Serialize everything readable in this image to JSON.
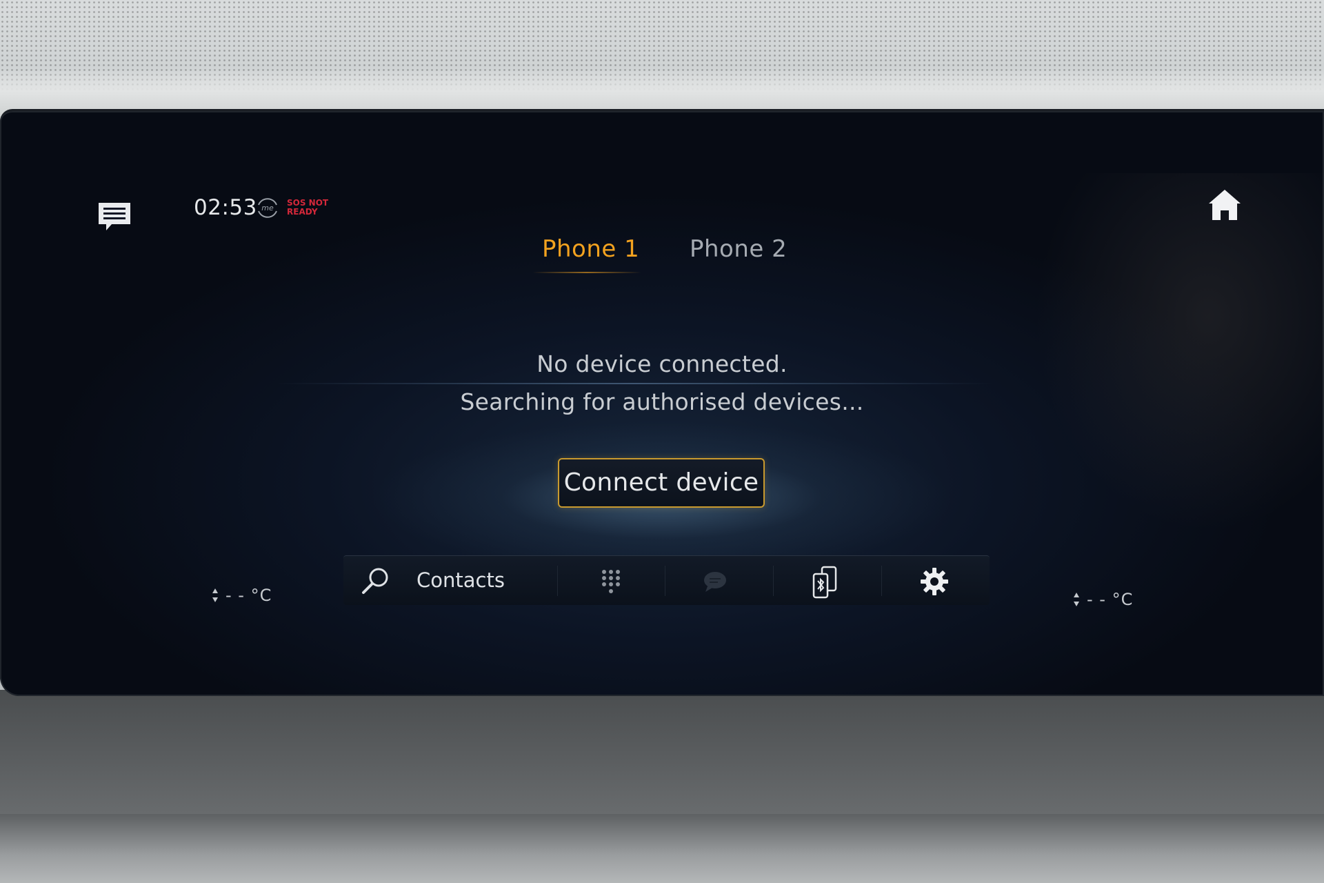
{
  "status_bar": {
    "time": "02:53",
    "me_label": "me",
    "sos_line1": "SOS NOT",
    "sos_line2": "READY"
  },
  "tabs": [
    {
      "label": "Phone 1",
      "active": true
    },
    {
      "label": "Phone 2",
      "active": false
    }
  ],
  "main": {
    "message_line1": "No device connected.",
    "message_line2": "Searching for authorised devices...",
    "connect_button": "Connect device"
  },
  "bottom_bar": {
    "contacts_label": "Contacts",
    "icons": [
      "search-icon",
      "keypad-icon",
      "chat-icon",
      "bluetooth-phone-icon",
      "gear-icon"
    ]
  },
  "climate": {
    "left_temp": "- - °C",
    "right_temp": "- - °C"
  },
  "colors": {
    "accent": "#f3a21f",
    "sos": "#d4283a",
    "button_border": "#c99a2e"
  }
}
